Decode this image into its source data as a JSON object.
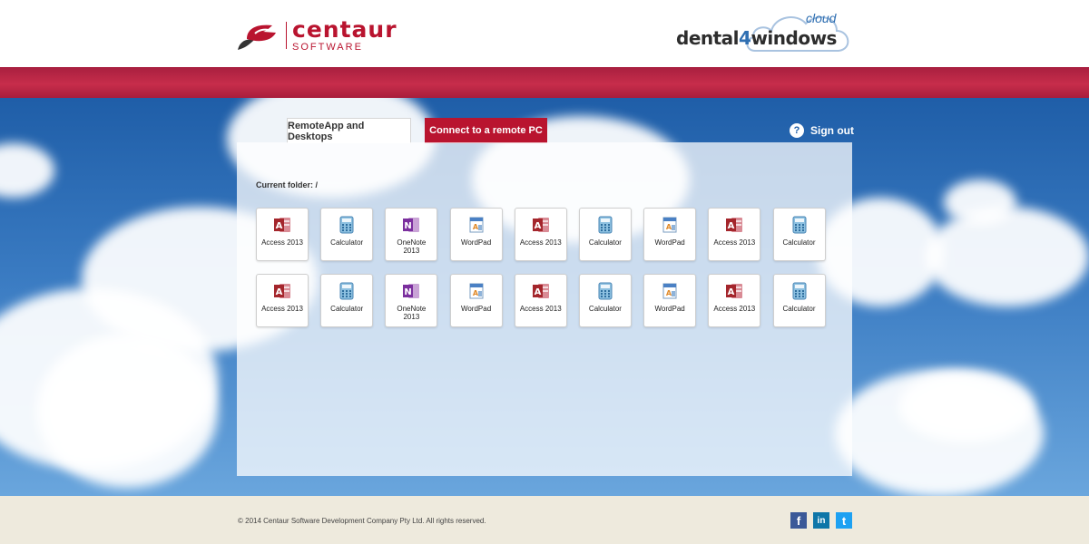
{
  "header": {
    "centaur_logo": {
      "wordmark": "centaur",
      "subline": "SOFTWARE"
    },
    "d4w_logo": {
      "cloud_word": "cloud",
      "brand_pre": "dental",
      "brand_num": "4",
      "brand_post": "windows"
    }
  },
  "tabs": [
    {
      "label": "RemoteApp and Desktops",
      "active": true
    },
    {
      "label": "Connect to a remote PC",
      "active": false
    }
  ],
  "sign_out": {
    "label": "Sign out"
  },
  "panel": {
    "current_folder": "Current folder: /",
    "apps": [
      {
        "label": "Access 2013",
        "icon": "access-icon"
      },
      {
        "label": "Calculator",
        "icon": "calculator-icon"
      },
      {
        "label": "OneNote 2013",
        "icon": "onenote-icon"
      },
      {
        "label": "WordPad",
        "icon": "wordpad-icon"
      },
      {
        "label": "Access 2013",
        "icon": "access-icon"
      },
      {
        "label": "Calculator",
        "icon": "calculator-icon"
      },
      {
        "label": "WordPad",
        "icon": "wordpad-icon"
      },
      {
        "label": "Access 2013",
        "icon": "access-icon"
      },
      {
        "label": "Calculator",
        "icon": "calculator-icon"
      },
      {
        "label": "Access 2013",
        "icon": "access-icon"
      },
      {
        "label": "Calculator",
        "icon": "calculator-icon"
      },
      {
        "label": "OneNote 2013",
        "icon": "onenote-icon"
      },
      {
        "label": "WordPad",
        "icon": "wordpad-icon"
      },
      {
        "label": "Access 2013",
        "icon": "access-icon"
      },
      {
        "label": "Calculator",
        "icon": "calculator-icon"
      },
      {
        "label": "WordPad",
        "icon": "wordpad-icon"
      },
      {
        "label": "Access 2013",
        "icon": "access-icon"
      },
      {
        "label": "Calculator",
        "icon": "calculator-icon"
      }
    ]
  },
  "footer": {
    "copyright": "© 2014 Centaur Software Development Company Pty Ltd. All rights reserved.",
    "social": [
      {
        "name": "facebook-icon",
        "glyph": "f",
        "color": "#3b5998"
      },
      {
        "name": "linkedin-icon",
        "glyph": "in",
        "color": "#0e76a8"
      },
      {
        "name": "twitter-icon",
        "glyph": "t",
        "color": "#1da1f2"
      }
    ]
  },
  "colors": {
    "brand_red": "#b9142f",
    "sky_blue": "#1f5ea8",
    "footer_bg": "#eeeadd"
  }
}
